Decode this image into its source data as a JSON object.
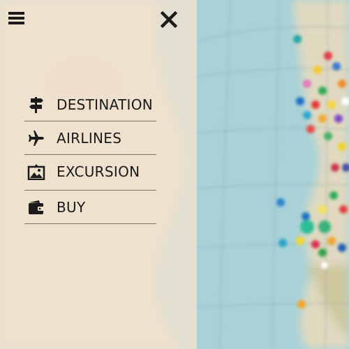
{
  "menu": {
    "items": [
      {
        "label": "DESTINATION",
        "icon": "signpost-icon"
      },
      {
        "label": "AIRLINES",
        "icon": "airplane-icon"
      },
      {
        "label": "EXCURSION",
        "icon": "landscape-picture-icon"
      },
      {
        "label": "BUY",
        "icon": "wallet-icon"
      }
    ]
  },
  "header": {
    "menu_icon": "hamburger-icon",
    "close_icon": "close-icon"
  },
  "background": {
    "description_colors": {
      "sea": "#a9d2d8",
      "land": "#e7dcc6",
      "panel": "#f0e2d0"
    }
  }
}
